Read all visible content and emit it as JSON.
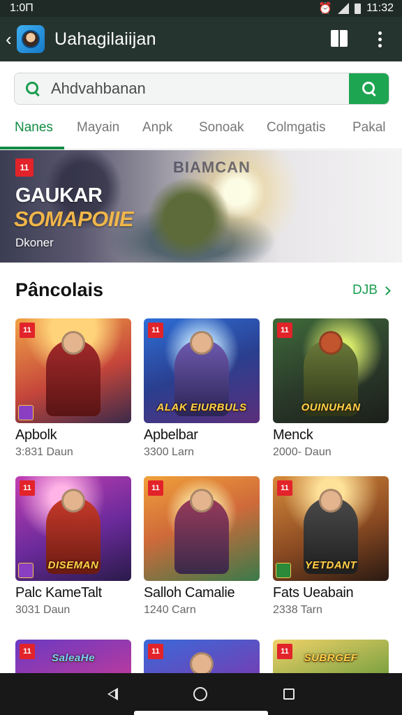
{
  "status_bar": {
    "time_left": "1:0П",
    "time_right": "11:32",
    "icons": [
      "alarm-icon",
      "signal-icon",
      "battery-icon"
    ]
  },
  "app_bar": {
    "title": "Uahagilaiijan",
    "back_icon": "chevron-left-icon",
    "actions": [
      "bookmark-icon",
      "more-vert-icon"
    ]
  },
  "search": {
    "placeholder": "Ahdvahbanan",
    "button_icon": "search-icon"
  },
  "tabs": [
    {
      "label": "Nanes",
      "active": true
    },
    {
      "label": "Mayain",
      "active": false
    },
    {
      "label": "Anpk",
      "active": false
    },
    {
      "label": "Sonoak",
      "active": false
    },
    {
      "label": "Colmgatis",
      "active": false
    },
    {
      "label": "Pakal",
      "active": false
    }
  ],
  "banner": {
    "badge": "11",
    "overlay_text": "BIAMCAN",
    "title": "GAUKAR",
    "subtitle": "SOMAPOIIE",
    "caption": "Dkoner"
  },
  "section": {
    "title": "Pâncolais",
    "more_label": "DJB"
  },
  "games": [
    {
      "title": "Apbolk",
      "count": "3:831 Daun",
      "badge": "11",
      "art_text": ""
    },
    {
      "title": "Apbelbar",
      "count": "3300 Larn",
      "badge": "11",
      "art_text": "ALAK EIURBULS"
    },
    {
      "title": "Menck",
      "count": "2000- Daun",
      "badge": "11",
      "art_text": "OUINUHAN"
    },
    {
      "title": "Palc KameTalt",
      "count": "3031 Daun",
      "badge": "11",
      "art_text": "DISEMAN"
    },
    {
      "title": "Salloh Camalie",
      "count": "1240 Carn",
      "badge": "11",
      "art_text": ""
    },
    {
      "title": "Fats Ueabain",
      "count": "2338 Tarn",
      "badge": "11",
      "art_text": "YETDANT"
    },
    {
      "title": "",
      "count": "",
      "badge": "11",
      "art_text": "SaleaHe"
    },
    {
      "title": "",
      "count": "",
      "badge": "11",
      "art_text": ""
    },
    {
      "title": "",
      "count": "",
      "badge": "11",
      "art_text": "SUBRGEF"
    }
  ],
  "nav_bar": {
    "icons": [
      "back-triangle-icon",
      "home-circle-icon",
      "recents-square-icon"
    ]
  },
  "colors": {
    "accent": "#1a9d4f",
    "app_bar": "#263430",
    "badge": "#e2232a"
  }
}
